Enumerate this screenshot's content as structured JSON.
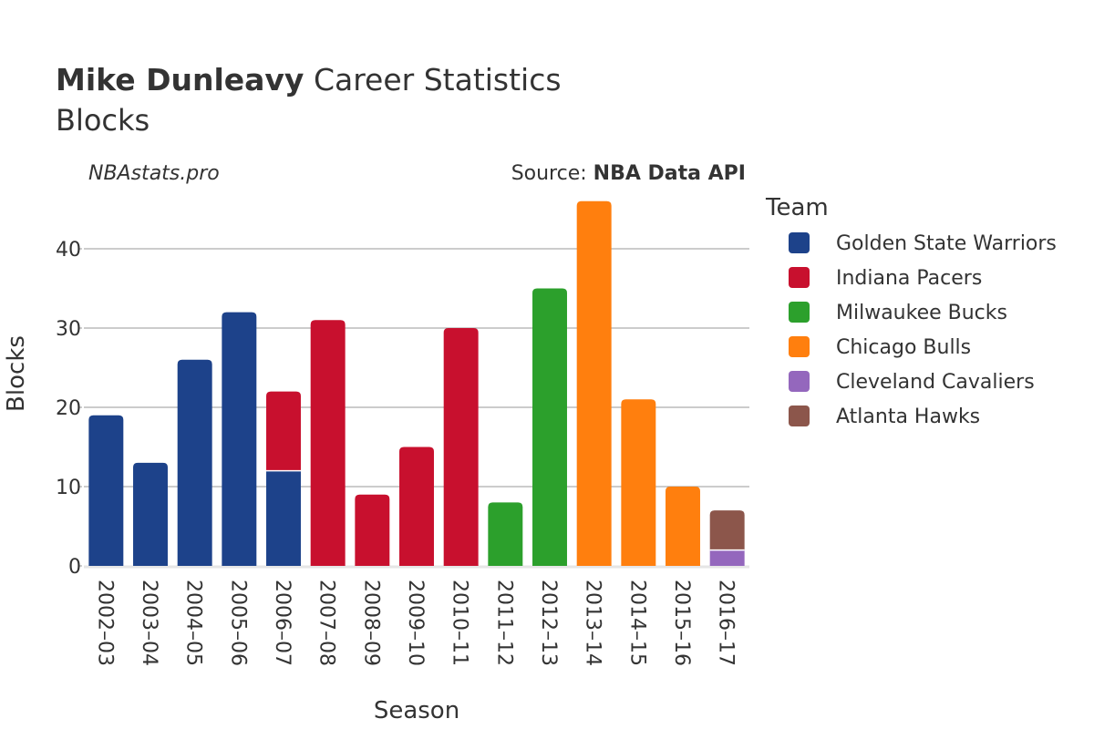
{
  "header": {
    "title_bold": "Mike Dunleavy",
    "title_rest": " Career Statistics",
    "subtitle": "Blocks",
    "watermark": "NBAstats.pro",
    "source_prefix": "Source: ",
    "source_name": "NBA Data API"
  },
  "chart_data": {
    "type": "bar",
    "stacked": true,
    "title": "Mike Dunleavy Career Statistics",
    "subtitle": "Blocks",
    "xlabel": "Season",
    "ylabel": "Blocks",
    "ylim": [
      0,
      47
    ],
    "yticks": [
      0,
      10,
      20,
      30,
      40
    ],
    "grid": true,
    "legend_title": "Team",
    "legend_position": "right",
    "categories": [
      "2002–03",
      "2003–04",
      "2004–05",
      "2005–06",
      "2006–07",
      "2007–08",
      "2008–09",
      "2009–10",
      "2010–11",
      "2011–12",
      "2012–13",
      "2013–14",
      "2014–15",
      "2015–16",
      "2016–17"
    ],
    "series": [
      {
        "name": "Golden State Warriors",
        "color": "#1d428a",
        "values": [
          19,
          13,
          26,
          32,
          12,
          0,
          0,
          0,
          0,
          0,
          0,
          0,
          0,
          0,
          0
        ]
      },
      {
        "name": "Indiana Pacers",
        "color": "#c8102e",
        "values": [
          0,
          0,
          0,
          0,
          10,
          31,
          9,
          15,
          30,
          0,
          0,
          0,
          0,
          0,
          0
        ]
      },
      {
        "name": "Milwaukee Bucks",
        "color": "#2ca02c",
        "values": [
          0,
          0,
          0,
          0,
          0,
          0,
          0,
          0,
          0,
          8,
          35,
          0,
          0,
          0,
          0
        ]
      },
      {
        "name": "Chicago Bulls",
        "color": "#ff7f0e",
        "values": [
          0,
          0,
          0,
          0,
          0,
          0,
          0,
          0,
          0,
          0,
          0,
          46,
          21,
          10,
          0
        ]
      },
      {
        "name": "Cleveland Cavaliers",
        "color": "#9467bd",
        "values": [
          0,
          0,
          0,
          0,
          0,
          0,
          0,
          0,
          0,
          0,
          0,
          0,
          0,
          0,
          2
        ]
      },
      {
        "name": "Atlanta Hawks",
        "color": "#8c564b",
        "values": [
          0,
          0,
          0,
          0,
          0,
          0,
          0,
          0,
          0,
          0,
          0,
          0,
          0,
          0,
          5
        ]
      }
    ]
  }
}
